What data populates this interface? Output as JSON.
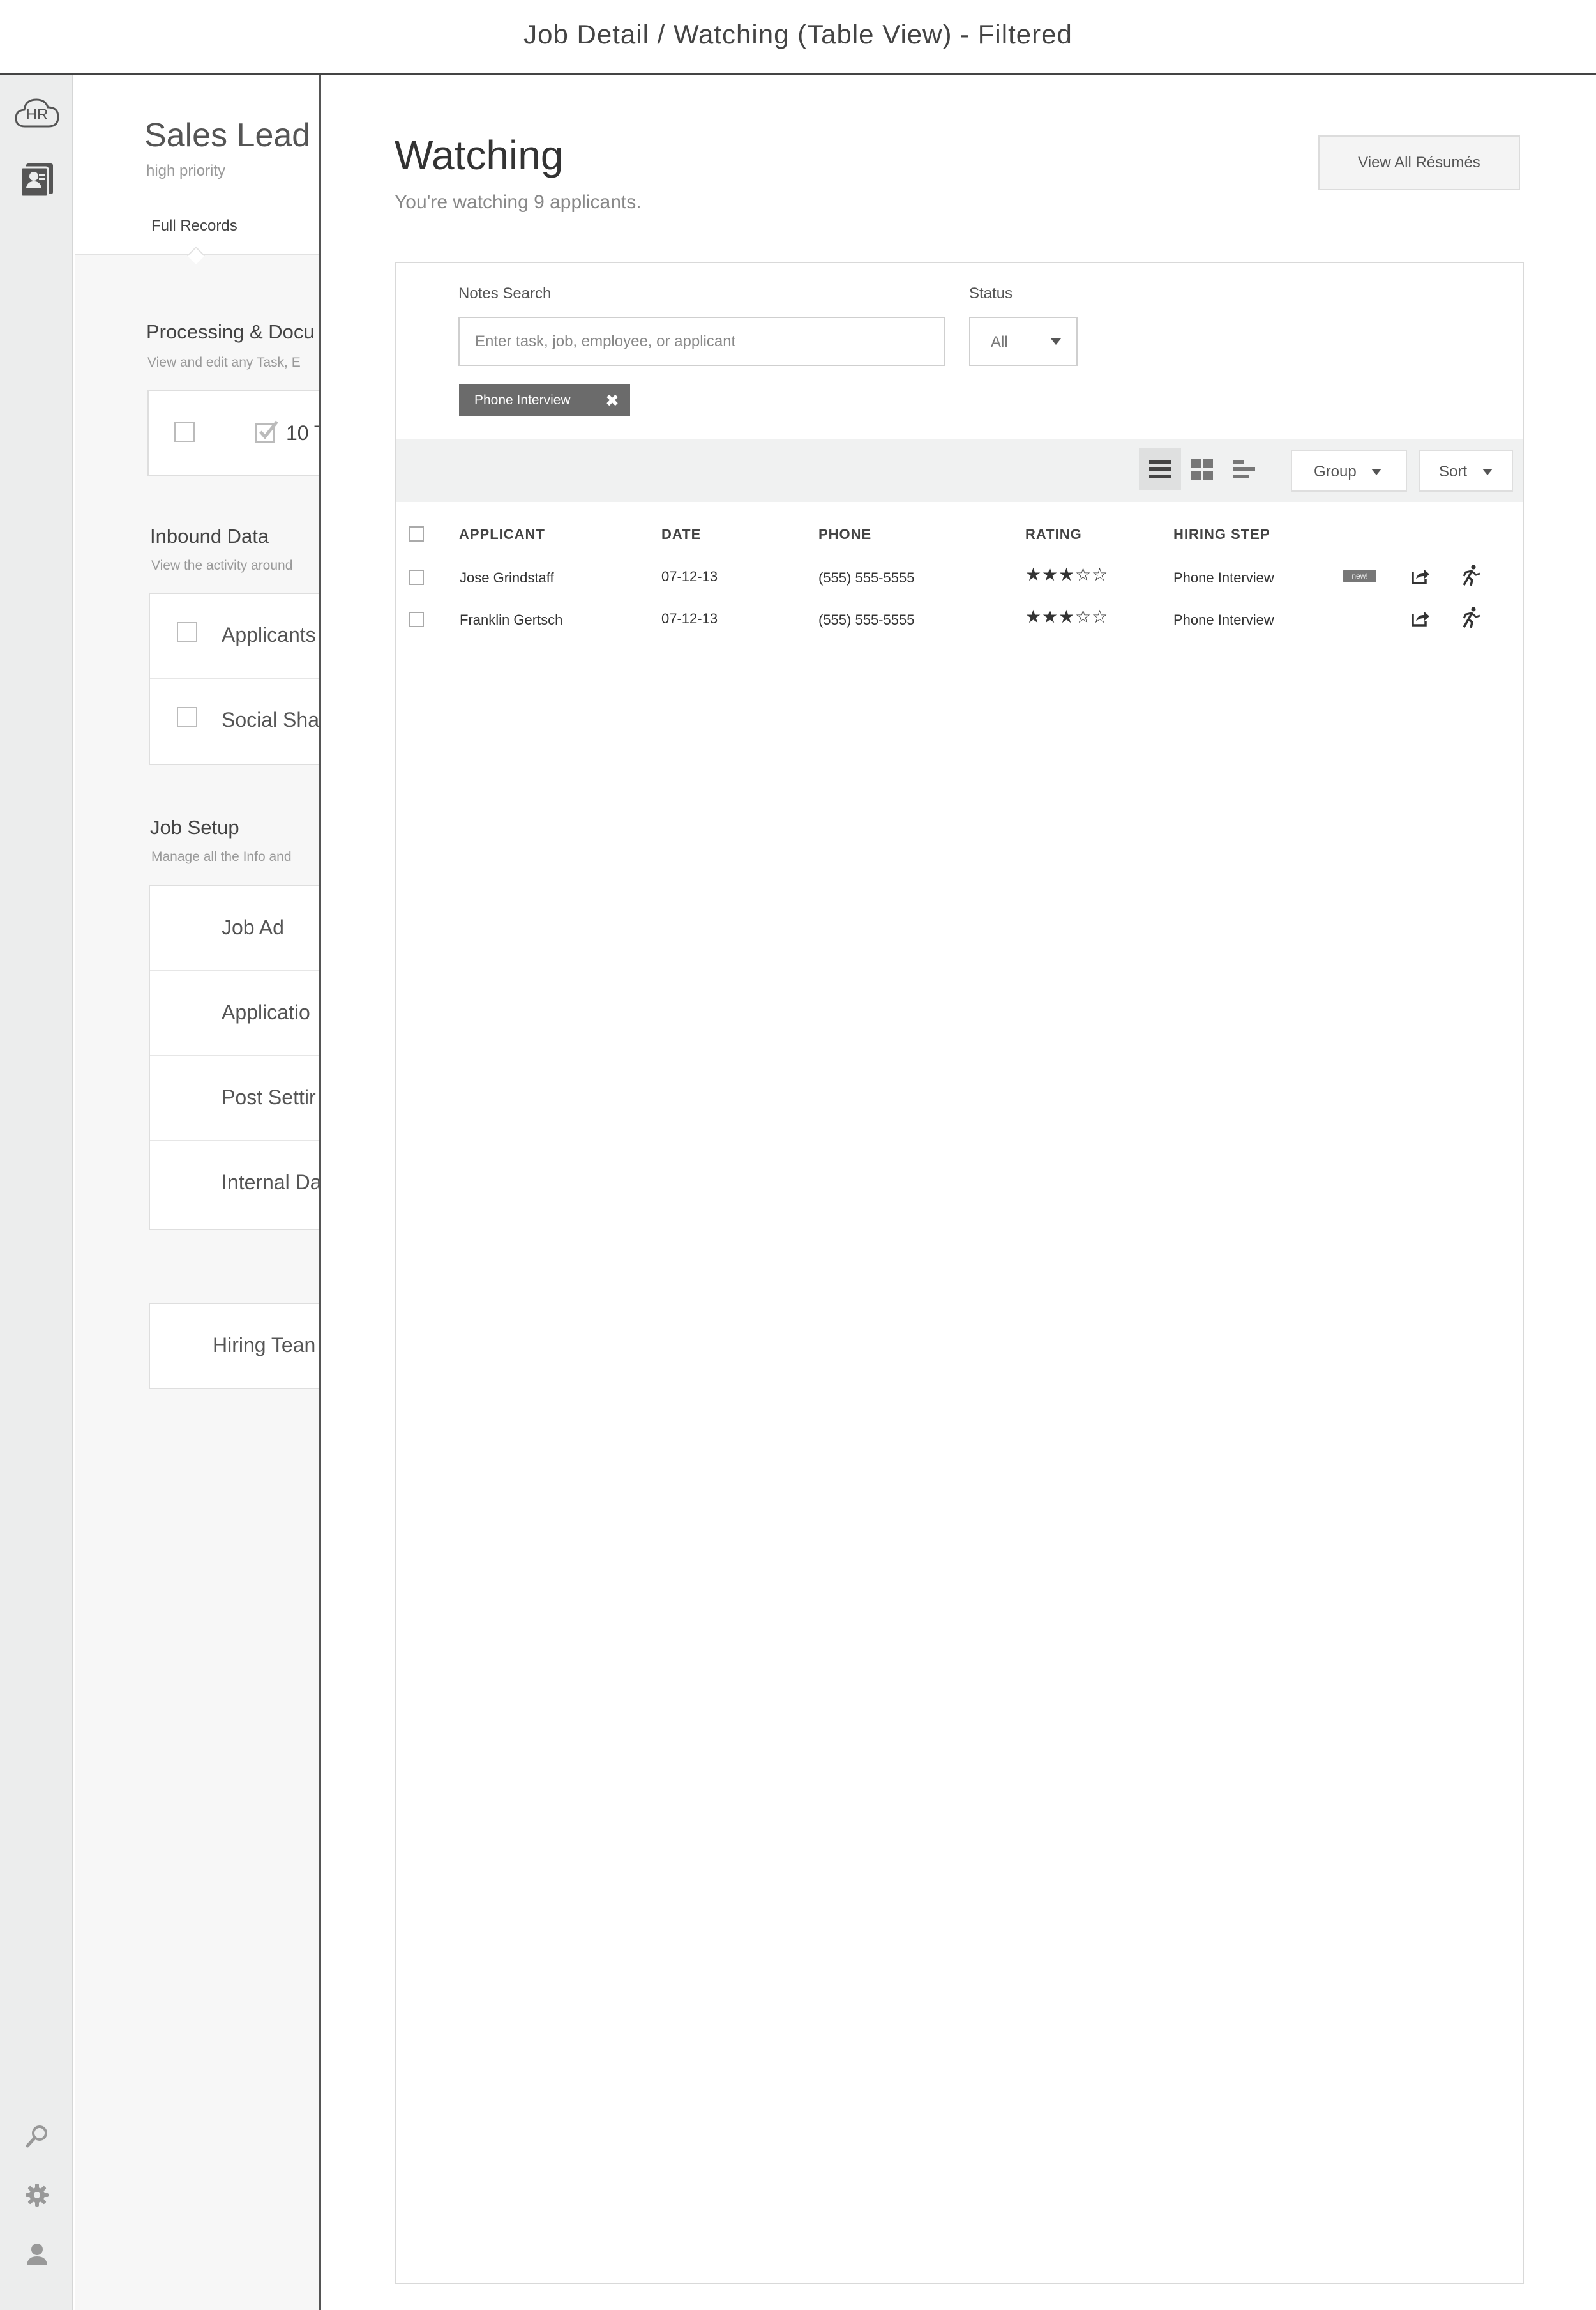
{
  "page_title": "Job Detail / Watching (Table View) - Filtered",
  "rail": {
    "logo_text": "HR"
  },
  "job": {
    "title": "Sales Lead",
    "priority": "high priority",
    "active_tab": "Full Records",
    "sections": {
      "processing": {
        "title": "Processing & Docu",
        "subtitle": "View and edit any Task, E",
        "task_count": "10 T"
      },
      "inbound": {
        "title": "Inbound Data",
        "subtitle": "View the activity around",
        "items": [
          "Applicants",
          "Social Sha"
        ]
      },
      "setup": {
        "title": "Job Setup",
        "subtitle": "Manage all the Info and",
        "items": [
          "Job Ad",
          "Applicatio",
          "Post Settir",
          "Internal Da"
        ]
      },
      "hiring_team": "Hiring Tean"
    }
  },
  "watching": {
    "title": "Watching",
    "subtitle": "You're watching 9 applicants.",
    "view_all_label": "View All Résumés",
    "notes_label": "Notes Search",
    "notes_placeholder": "Enter task, job, employee, or applicant",
    "status_label": "Status",
    "status_value": "All",
    "filter_chip": "Phone Interview",
    "group_label": "Group",
    "sort_label": "Sort",
    "columns": {
      "applicant": "APPLICANT",
      "date": "DATE",
      "phone": "PHONE",
      "rating": "RATING",
      "hiring_step": "HIRING STEP"
    },
    "rows": [
      {
        "applicant": "Jose Grindstaff",
        "date": "07-12-13",
        "phone": "(555) 555-5555",
        "rating": 3,
        "max_rating": 5,
        "hiring_step": "Phone Interview",
        "badge": "new!"
      },
      {
        "applicant": "Franklin Gertsch",
        "date": "07-12-13",
        "phone": "(555) 555-5555",
        "rating": 3,
        "max_rating": 5,
        "hiring_step": "Phone Interview"
      }
    ]
  },
  "colors": {
    "rail_bg": "#eceded",
    "chip_bg": "#6b6b6b",
    "toolbar_bg": "#f0f1f1"
  }
}
